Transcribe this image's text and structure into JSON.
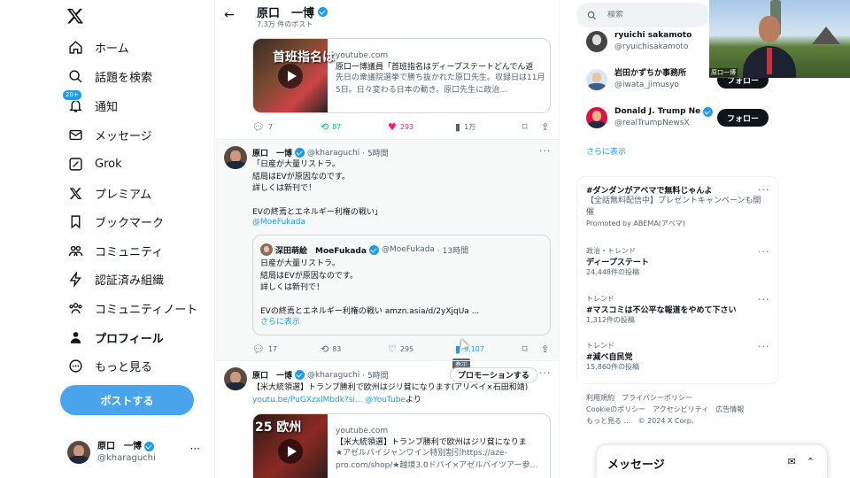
{
  "nav": {
    "items": [
      {
        "label": "ホーム",
        "icon": "home-icon"
      },
      {
        "label": "話題を検索",
        "icon": "search-icon"
      },
      {
        "label": "通知",
        "icon": "bell-icon",
        "badge": "20+"
      },
      {
        "label": "メッセージ",
        "icon": "envelope-icon"
      },
      {
        "label": "Grok",
        "icon": "grok-icon"
      },
      {
        "label": "プレミアム",
        "icon": "x-icon"
      },
      {
        "label": "ブックマーク",
        "icon": "bookmark-icon"
      },
      {
        "label": "コミュニティ",
        "icon": "community-icon"
      },
      {
        "label": "認証済み組織",
        "icon": "lightning-icon"
      },
      {
        "label": "コミュニティノート",
        "icon": "notes-icon"
      },
      {
        "label": "プロフィール",
        "icon": "person-icon"
      },
      {
        "label": "もっと見る",
        "icon": "more-circle-icon"
      }
    ],
    "post_button": "ポストする",
    "me": {
      "name": "原口　一博",
      "handle": "@kharaguchi"
    }
  },
  "header": {
    "name": "原口　一博",
    "post_count": "7.3万 件のポスト"
  },
  "tweet1": {
    "card": {
      "domain": "youtube.com",
      "title": "原口一博議員「首班指名はディープステートどんでん返",
      "desc": "先日の衆議院選挙で勝ち抜かれた原口先生。収録日は11月5日。日々変わる日本の動き。原口先生に政治…",
      "thumb_text": "首班指名は"
    },
    "replies": "7",
    "retweets": "87",
    "likes": "293",
    "views": "1万"
  },
  "tweet2": {
    "name": "原口　一博",
    "handle": "@kharaguchi",
    "time": "· 5時間",
    "text": "「日産が大量リストラ。\n結局はEVが原因なのです。\n詳しくは新刊で！\n\nEVの終焉とエネルギー利権の戦い」",
    "mention": "@MoeFukada",
    "quote": {
      "name": "深田萌絵　MoeFukada",
      "handle": "@MoeFukada",
      "time": "· 13時間",
      "text": "日産が大量リストラ。\n結局はEVが原因なのです。\n詳しくは新刊で！\n\nEVの終焉とエネルギー利権の戦い amzn.asia/d/2yXjqUa ...",
      "show_more": "さらに表示"
    },
    "replies": "17",
    "retweets": "83",
    "likes": "295",
    "views": "9,107",
    "tooltip": "表示"
  },
  "tweet3": {
    "name": "原口　一博",
    "handle": "@kharaguchi",
    "time": "· 5時間",
    "promote": "プロモーションする",
    "text": "【米大統領選】トランプ勝利で欧州はジリ貧になります(アリベイ×石田和靖)",
    "link": "youtu.be/PuGXzxlMbdk?si...",
    "link_suffix_pre": " ",
    "link_mention": "@YouTube",
    "link_suffix": "より",
    "card": {
      "domain": "youtube.com",
      "title": "【米大統領選】トランプ勝利で欧州はジリ貧になりま",
      "desc": "★アゼルバイジャンワイン特別割引https://aze-pro.com/shop/★越境3.0ドバイ×アゼルバイツアー参…",
      "thumb_text": "25 欧州"
    }
  },
  "right": {
    "search_placeholder": "検索",
    "who_to_follow": [
      {
        "name": "ryuichi sakamoto",
        "handle": "@ryuichisakamoto",
        "verified": false,
        "button": ""
      },
      {
        "name": "岩田かずちか事務所",
        "handle": "@iwata_jimusyo",
        "verified": false,
        "button": "フォロー"
      },
      {
        "name": "Donald J. Trump Ne",
        "handle": "@realTrumpNewsX",
        "verified": true,
        "button": "フォロー"
      }
    ],
    "show_more": "さらに表示",
    "trends": [
      {
        "category": "",
        "title": "#ダンダンがアベマで無料じゃんよ",
        "desc": "【全話無料配信中】プレゼントキャンペーンも開催",
        "count": "Promoted by ABEMA(アベマ)"
      },
      {
        "category": "政治・トレンド",
        "title": "ディープステート",
        "desc": "",
        "count": "24,448件の投稿"
      },
      {
        "category": "トレンド",
        "title": "#マスコミは不公平な報道をやめて下さい",
        "desc": "",
        "count": "1,312件の投稿"
      },
      {
        "category": "トレンド",
        "title": "#減ベ自民党",
        "desc": "",
        "count": "15,860件の投稿"
      }
    ],
    "footer": [
      "利用規約",
      "プライバシーポリシー",
      "Cookieのポリシー",
      "アクセシビリティ",
      "広告情報",
      "もっと見る …",
      "© 2024 X Corp."
    ],
    "messages_title": "メッセージ"
  },
  "webcam": {
    "label": "原口一博"
  },
  "colors": {
    "accent": "#1d9bf0",
    "like": "#f91880",
    "retweet": "#00ba7c",
    "post_button": "#4aa4eb"
  }
}
